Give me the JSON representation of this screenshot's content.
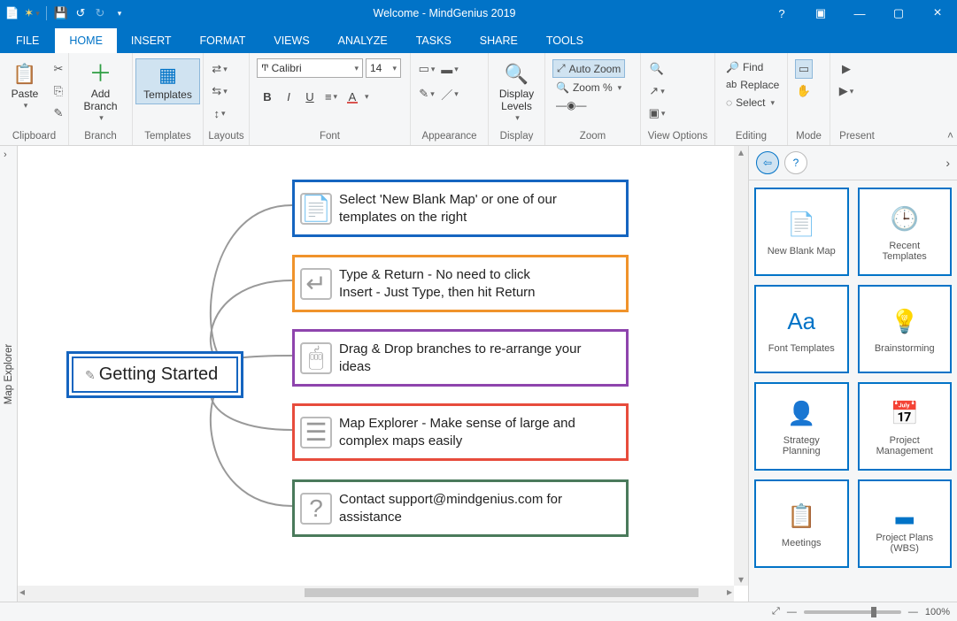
{
  "title": "Welcome - MindGenius 2019",
  "tabs": {
    "file": "FILE",
    "home": "HOME",
    "insert": "INSERT",
    "format": "FORMAT",
    "views": "VIEWS",
    "analyze": "ANALYZE",
    "tasks": "TASKS",
    "share": "SHARE",
    "tools": "TOOLS"
  },
  "ribbon": {
    "clipboard": {
      "paste": "Paste",
      "label": "Clipboard"
    },
    "branch": {
      "add": "Add\nBranch",
      "label": "Branch"
    },
    "templates": {
      "btn": "Templates",
      "label": "Templates"
    },
    "layouts": {
      "label": "Layouts"
    },
    "font": {
      "name": "Calibri",
      "size": "14",
      "label": "Font"
    },
    "appearance": {
      "label": "Appearance"
    },
    "display": {
      "levels": "Display\nLevels",
      "label": "Display"
    },
    "zoom": {
      "auto": "Auto Zoom",
      "pct": "Zoom %",
      "label": "Zoom"
    },
    "viewopts": {
      "label": "View Options"
    },
    "editing": {
      "find": "Find",
      "replace": "Replace",
      "select": "Select",
      "label": "Editing"
    },
    "mode": {
      "label": "Mode"
    },
    "present": {
      "label": "Present"
    }
  },
  "explorer": "Map Explorer",
  "map": {
    "root": "Getting Started",
    "children": [
      {
        "icon": "📄",
        "color": "#1565c0",
        "text": "Select 'New Blank Map' or one of our templates on the right"
      },
      {
        "icon": "↵",
        "color": "#f0932b",
        "text": "Type & Return - No need to click\nInsert - Just Type, then hit Return"
      },
      {
        "icon": "🖱",
        "color": "#8e44ad",
        "text": "Drag & Drop branches to re-arrange your ideas"
      },
      {
        "icon": "☰",
        "color": "#e74c3c",
        "text": "Map Explorer - Make sense of large and complex maps easily"
      },
      {
        "icon": "?",
        "color": "#4a7a5b",
        "text": "Contact support@mindgenius.com for assistance"
      }
    ]
  },
  "templates": [
    {
      "icon": "📄",
      "label": "New Blank Map"
    },
    {
      "icon": "🕒",
      "label": "Recent\nTemplates"
    },
    {
      "icon": "Aa",
      "label": "Font Templates"
    },
    {
      "icon": "💡",
      "label": "Brainstorming"
    },
    {
      "icon": "👤",
      "label": "Strategy\nPlanning"
    },
    {
      "icon": "📅",
      "label": "Project\nManagement"
    },
    {
      "icon": "📋",
      "label": "Meetings"
    },
    {
      "icon": "▂",
      "label": "Project Plans\n(WBS)"
    }
  ],
  "status": {
    "zoom": "100%"
  }
}
